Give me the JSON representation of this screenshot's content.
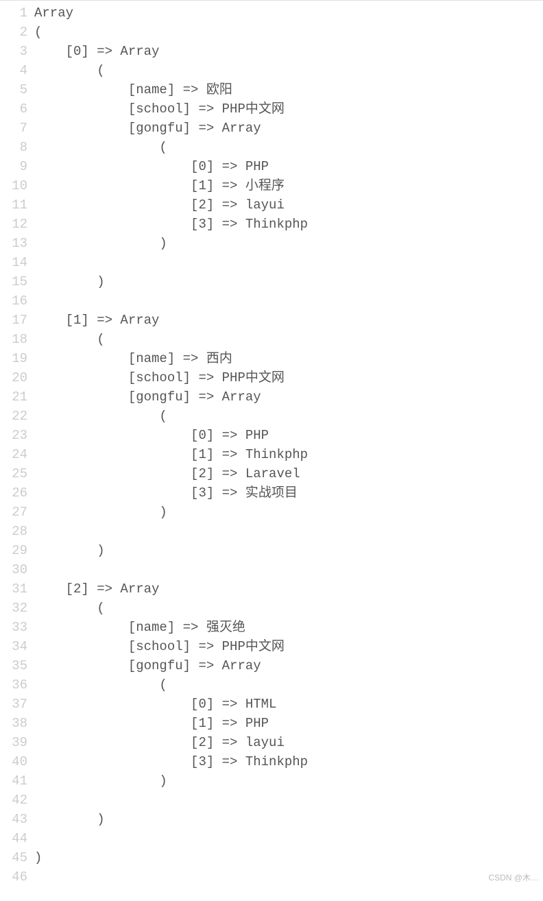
{
  "lines": [
    "Array",
    "(",
    "    [0] => Array",
    "        (",
    "            [name] => 欧阳",
    "            [school] => PHP中文网",
    "            [gongfu] => Array",
    "                (",
    "                    [0] => PHP",
    "                    [1] => 小程序",
    "                    [2] => layui",
    "                    [3] => Thinkphp",
    "                )",
    "",
    "        )",
    "",
    "    [1] => Array",
    "        (",
    "            [name] => 西内",
    "            [school] => PHP中文网",
    "            [gongfu] => Array",
    "                (",
    "                    [0] => PHP",
    "                    [1] => Thinkphp",
    "                    [2] => Laravel",
    "                    [3] => 实战项目",
    "                )",
    "",
    "        )",
    "",
    "    [2] => Array",
    "        (",
    "            [name] => 强灭绝",
    "            [school] => PHP中文网",
    "            [gongfu] => Array",
    "                (",
    "                    [0] => HTML",
    "                    [1] => PHP",
    "                    [2] => layui",
    "                    [3] => Thinkphp",
    "                )",
    "",
    "        )",
    "",
    ")",
    ""
  ],
  "watermark": "CSDN @木…"
}
